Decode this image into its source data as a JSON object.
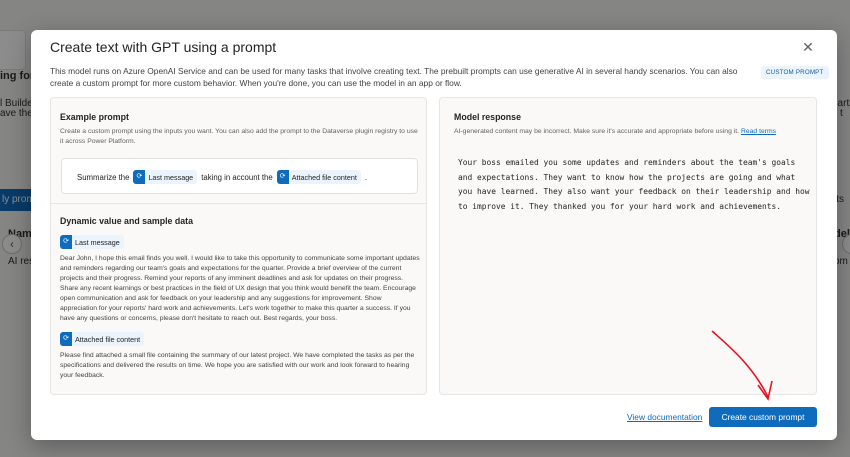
{
  "background": {
    "header_left": "ing for A",
    "card_line1": "l Builder m",
    "card_line2": "ave their c",
    "pill_label": "ly prompt",
    "left_col_header": "Name",
    "left_col_row": "AI resu",
    "right_pill": "its",
    "right_col_header": "del t",
    "right_col_row": "om P",
    "right_snippet": ", arti",
    "right_snippet2": "t",
    "nav_left": "‹",
    "nav_right": "›"
  },
  "dialog": {
    "title": "Create text with GPT using a prompt",
    "close_icon": "✕",
    "description": "This model runs on Azure OpenAI Service and can be used for many tasks that involve creating text. The prebuilt prompts can use generative AI in several handy scenarios. You can also create a custom prompt for more custom behavior. When you're done, you can use the model in an app or flow.",
    "badge": "CUSTOM PROMPT",
    "example": {
      "heading": "Example prompt",
      "description": "Create a custom prompt using the inputs you want. You can also add the prompt to the Dataverse plugin registry to use it across Power Platform.",
      "prompt_start": "Summarize the",
      "chip1": "Last message",
      "prompt_middle": "taking in account the",
      "chip2": "Attached file content",
      "prompt_end": "."
    },
    "dynamic": {
      "heading": "Dynamic value and sample data",
      "chip1": "Last message",
      "sample1": "Dear John, I hope this email finds you well. I would like to take this opportunity to communicate some important updates and reminders regarding our team's goals and expectations for the quarter. Provide a brief overview of the current projects and their progress. Remind your reports of any imminent deadlines and ask for updates on their progress. Share any recent learnings or best practices in the field of UX design that you think would benefit the team. Encourage open communication and ask for feedback on your leadership and any suggestions for improvement. Show appreciation for your reports' hard work and achievements. Let's work together to make this quarter a success. If you have any questions or concerns, please don't hesitate to reach out. Best regards, your boss.",
      "chip2": "Attached file content",
      "sample2": "Please find attached a small file containing the summary of our latest project. We have completed the tasks as per the specifications and delivered the results on time. We hope you are satisfied with our work and look forward to hearing your feedback."
    },
    "response": {
      "heading": "Model response",
      "disclaimer": "AI-generated content may be incorrect. Make sure it's accurate and appropriate before using it.",
      "read_terms": "Read terms",
      "text": "Your boss emailed you some updates and reminders about the team's goals and expectations. They want to know how the projects are going and what you have learned. They also want your feedback on their leadership and how to improve it. They thanked you for your hard work and achievements."
    },
    "view_documentation": "View documentation",
    "create_button": "Create custom prompt"
  },
  "colors": {
    "accent": "#0f6cbd",
    "annotation_arrow": "#e81123"
  }
}
